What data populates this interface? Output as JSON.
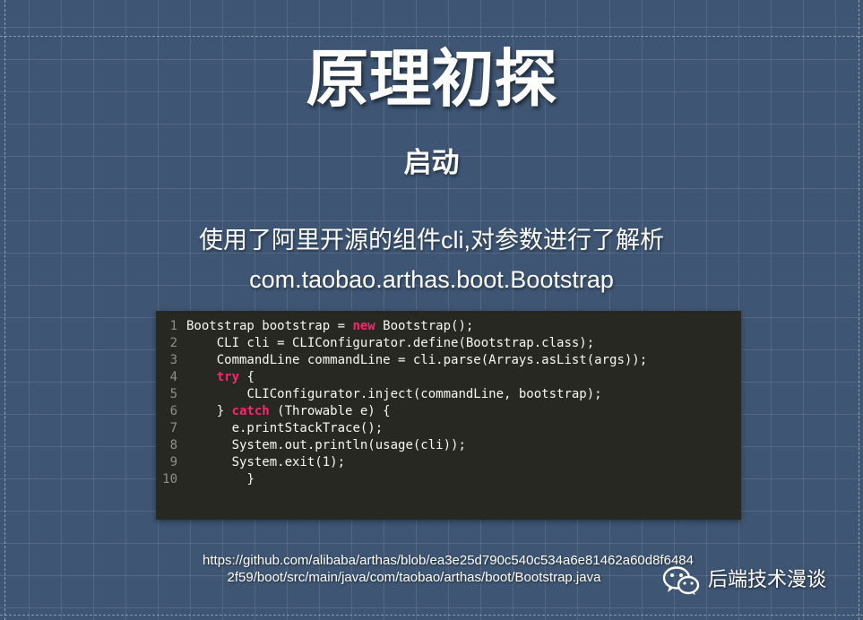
{
  "slide": {
    "title": "原理初探",
    "subtitle": "启动",
    "description_line1": "使用了阿里开源的组件cli,对参数进行了解析",
    "description_line2": "com.taobao.arthas.boot.Bootstrap"
  },
  "code": {
    "lines": [
      {
        "num": "1",
        "indent": "",
        "segments": [
          {
            "text": "Bootstrap bootstrap = "
          },
          {
            "text": "new",
            "kw": true
          },
          {
            "text": " Bootstrap();"
          }
        ]
      },
      {
        "num": "2",
        "indent": "    ",
        "segments": [
          {
            "text": "CLI cli = CLIConfigurator.define(Bootstrap.class);"
          }
        ]
      },
      {
        "num": "3",
        "indent": "    ",
        "segments": [
          {
            "text": "CommandLine commandLine = cli.parse(Arrays.asList(args));"
          }
        ]
      },
      {
        "num": "4",
        "indent": "    ",
        "segments": [
          {
            "text": "try",
            "kw": true
          },
          {
            "text": " {"
          }
        ]
      },
      {
        "num": "5",
        "indent": "        ",
        "segments": [
          {
            "text": "CLIConfigurator.inject(commandLine, bootstrap);"
          }
        ]
      },
      {
        "num": "6",
        "indent": "    ",
        "segments": [
          {
            "text": "} "
          },
          {
            "text": "catch",
            "kw": true
          },
          {
            "text": " (Throwable e) {"
          }
        ]
      },
      {
        "num": "7",
        "indent": "      ",
        "segments": [
          {
            "text": "e.printStackTrace();"
          }
        ]
      },
      {
        "num": "8",
        "indent": "      ",
        "segments": [
          {
            "text": "System.out.println(usage(cli));"
          }
        ]
      },
      {
        "num": "9",
        "indent": "      ",
        "segments": [
          {
            "text": "System.exit(1);"
          }
        ]
      },
      {
        "num": "10",
        "indent": "        ",
        "segments": [
          {
            "text": "}"
          }
        ]
      }
    ]
  },
  "footer": {
    "url_line1": "https://github.com/alibaba/arthas/blob/ea3e25d790c540c534a6e81462a60d8f6484",
    "url_line2": "2f59/boot/src/main/java/com/taobao/arthas/boot/Bootstrap.java",
    "watermark_icon": "wechat-icon",
    "watermark_text": "后端技术漫谈"
  },
  "colors": {
    "background": "#3e5674",
    "code_background": "#272822",
    "keyword": "#f92672"
  }
}
